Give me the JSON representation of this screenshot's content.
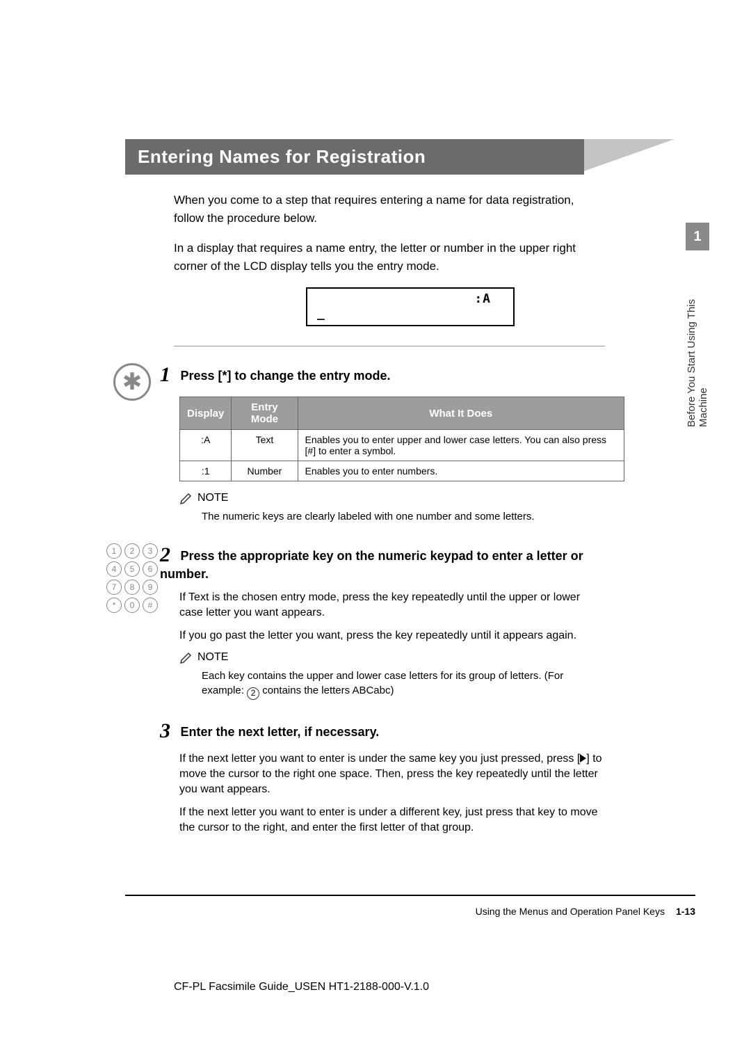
{
  "section": {
    "title": "Entering Names for Registration",
    "intro1": "When you come to a step that requires entering a name for data registration, follow the procedure below.",
    "intro2": "In a display that requires a name entry, the letter or number in the upper right corner of the LCD display tells you the entry mode."
  },
  "lcd": {
    "topright": ":A",
    "cursor": "_"
  },
  "step1": {
    "num": "1",
    "title_prefix": "Press [",
    "title_star": "*",
    "title_suffix": "] to change the entry mode.",
    "table": {
      "headers": [
        "Display",
        "Entry Mode",
        "What It Does"
      ],
      "rows": [
        {
          "display": ":A",
          "mode": "Text",
          "desc": "Enables you to enter upper and lower case letters. You can also press [#] to enter a symbol."
        },
        {
          "display": ":1",
          "mode": "Number",
          "desc": "Enables you to enter numbers."
        }
      ]
    },
    "note_label": "NOTE",
    "note_text": "The numeric keys are clearly labeled with one number and some letters."
  },
  "step2": {
    "num": "2",
    "title": "Press the appropriate key on the numeric keypad to enter a letter or number.",
    "p1": "If Text is the chosen entry mode, press the key repeatedly until the upper or lower case letter you want appears.",
    "p2": "If you go past the letter you want, press the key repeatedly until it appears again.",
    "note_label": "NOTE",
    "note_line1_prefix": "Each key contains the upper and lower case letters for its group of letters. (For example: ",
    "note_line1_circle": "2",
    "note_line1_suffix": " contains the letters ABCabc)"
  },
  "step3": {
    "num": "3",
    "title": "Enter the next letter, if necessary.",
    "p1_prefix": "If the next letter you want to enter is under the same key you just pressed, press [",
    "p1_suffix": "] to move the cursor to the right one space. Then, press the key repeatedly until the letter you want appears.",
    "p2": "If the next letter you want to enter is under a different key, just press that key to move the cursor to the right, and enter the first letter of that group."
  },
  "sidebar": {
    "chapter": "1",
    "label": "Before You Start Using This Machine"
  },
  "footer": {
    "text": "Using the Menus and Operation Panel Keys",
    "page": "1-13"
  },
  "doc_id": "CF-PL Facsimile Guide_USEN HT1-2188-000-V.1.0",
  "keypad": [
    "1",
    "2",
    "3",
    "4",
    "5",
    "6",
    "7",
    "8",
    "9",
    "*",
    "0",
    "#"
  ]
}
